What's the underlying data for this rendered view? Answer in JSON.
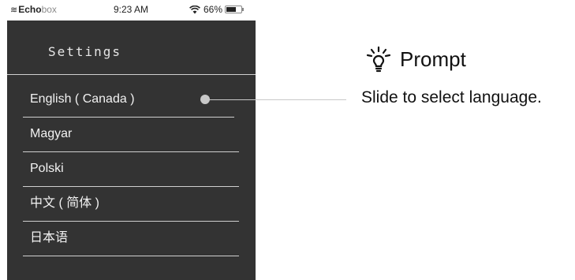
{
  "status_bar": {
    "brand_mark": "≋",
    "brand_bold": "Echo",
    "brand_light": "box",
    "time": "9:23 AM",
    "battery_percent": "66%",
    "battery_level": 0.66,
    "wifi_icon": "wifi-icon",
    "battery_icon": "battery-icon"
  },
  "settings": {
    "title": "Settings",
    "languages": [
      {
        "label": "English ( Canada )",
        "selected": true
      },
      {
        "label": "Magyar"
      },
      {
        "label": "Polski"
      },
      {
        "label": "中文 ( 简体 )"
      },
      {
        "label": "日本语"
      }
    ]
  },
  "prompt": {
    "icon": "lightbulb-icon",
    "title": "Prompt",
    "text": "Slide to select language."
  },
  "colors": {
    "screen_bg": "#333333",
    "text_light": "#f2f2f2",
    "divider": "#cfcfcf"
  }
}
